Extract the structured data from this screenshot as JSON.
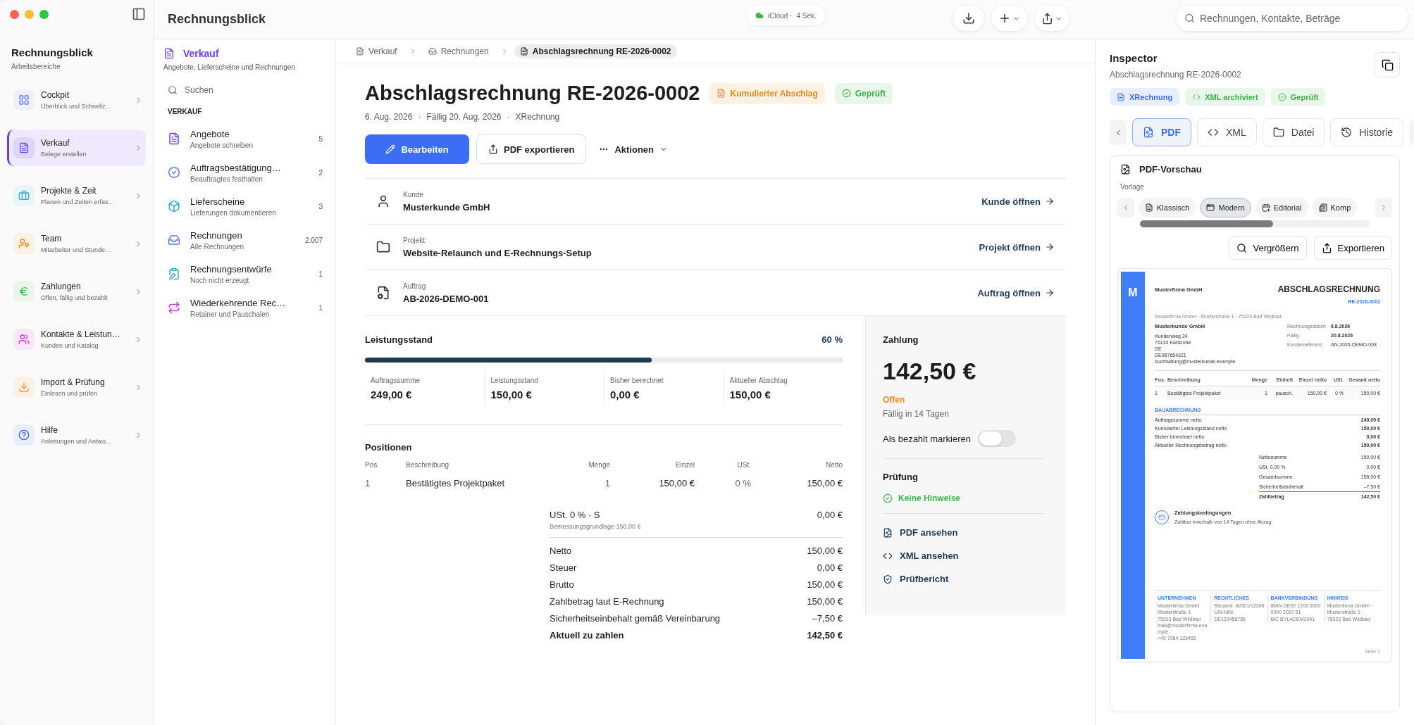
{
  "window": {
    "title": "Rechnungsblick"
  },
  "toolbar": {
    "sync_label": "iCloud ·",
    "sync_time": "4 Sek.",
    "search": {
      "placeholder": "Rechnungen, Kontakte, Beträge"
    }
  },
  "sidebar": {
    "title": "Rechnungsblick",
    "subtitle": "Arbeitsbereiche",
    "items": [
      {
        "label": "Cockpit",
        "sub": "Überblick und Schnellz…",
        "selected": false
      },
      {
        "label": "Verkauf",
        "sub": "Belege erstellen",
        "selected": true
      },
      {
        "label": "Projekte & Zeit",
        "sub": "Planen und Zeiten erfas…",
        "selected": false
      },
      {
        "label": "Team",
        "sub": "Mitarbeiter und Stunde…",
        "selected": false
      },
      {
        "label": "Zahlungen",
        "sub": "Offen, fällig und bezahlt",
        "selected": false
      },
      {
        "label": "Kontakte & Leistun…",
        "sub": "Kunden und Katalog",
        "selected": false
      },
      {
        "label": "Import & Prüfung",
        "sub": "Einlesen und prüfen",
        "selected": false
      },
      {
        "label": "Hilfe",
        "sub": "Anleitungen und Antwo…",
        "selected": false
      }
    ]
  },
  "list_pane": {
    "title": "Verkauf",
    "subtitle": "Angebote, Lieferscheine und Rechnungen",
    "search": {
      "placeholder": "Suchen"
    },
    "section": "VERKAUF",
    "items": [
      {
        "label": "Angebote",
        "sub": "Angebote schreiben",
        "count": "5"
      },
      {
        "label": "Auftragsbestätigung…",
        "sub": "Beauftragtes festhalten",
        "count": "2"
      },
      {
        "label": "Lieferscheine",
        "sub": "Lieferungen dokumentieren",
        "count": "3"
      },
      {
        "label": "Rechnungen",
        "sub": "Alle Rechnungen",
        "count": "2.007"
      },
      {
        "label": "Rechnungsentwürfe",
        "sub": "Noch nicht erzeugt",
        "count": "1"
      },
      {
        "label": "Wiederkehrende Rec…",
        "sub": "Retainer und Pauschalen",
        "count": "1"
      }
    ]
  },
  "breadcrumb": [
    {
      "label": "Verkauf",
      "selected": false
    },
    {
      "label": "Rechnungen",
      "selected": false
    },
    {
      "label": "Abschlagsrechnung RE-2026-0002",
      "selected": true
    }
  ],
  "document": {
    "title": "Abschlagsrechnung RE-2026-0002",
    "badges": [
      {
        "label": "Kumulierter Abschlag",
        "kind": "warning"
      },
      {
        "label": "Geprüft",
        "kind": "success"
      }
    ],
    "meta": [
      "6. Aug. 2026",
      "Fällig 20. Aug. 2026",
      "XRechnung"
    ],
    "meta_separator": "·",
    "actions": [
      {
        "label": "Bearbeiten",
        "kind": "primary"
      },
      {
        "label": "PDF exportieren",
        "kind": "secondary"
      },
      {
        "label": "Aktionen",
        "kind": "menu"
      }
    ],
    "links": [
      {
        "label": "Kunde",
        "value": "Musterkunde GmbH",
        "action": "Kunde öffnen"
      },
      {
        "label": "Projekt",
        "value": "Website-Relaunch und E-Rechnungs-Setup",
        "action": "Projekt öffnen"
      },
      {
        "label": "Auftrag",
        "value": "AB-2026-DEMO-001",
        "action": "Auftrag öffnen"
      }
    ],
    "progress": {
      "label": "Leistungsstand",
      "percent": "60 %",
      "level": 0.6
    },
    "stats": [
      {
        "label": "Auftragssumme",
        "value": "249,00 €"
      },
      {
        "label": "Leistungsstand",
        "value": "150,00 €"
      },
      {
        "label": "Bisher berechnet",
        "value": "0,00 €"
      },
      {
        "label": "Aktueller Abschlag",
        "value": "150,00 €"
      }
    ],
    "positions": {
      "title": "Positionen",
      "columns": [
        "Pos.",
        "Beschreibung",
        "Menge",
        "Einzel",
        "USt.",
        "Netto"
      ],
      "rows": [
        [
          "1",
          "Bestätigtes Projektpaket",
          "1",
          "150,00 €",
          "0 %",
          "150,00 €"
        ]
      ]
    },
    "tax": {
      "label": "USt. 0 % · S",
      "sub": "Bemessungsgrundlage 150,00 €",
      "value": "0,00 €"
    },
    "totals": [
      {
        "label": "Netto",
        "value": "150,00 €",
        "kind": "line"
      },
      {
        "label": "Steuer",
        "value": "0,00 €",
        "kind": "line"
      },
      {
        "label": "Brutto",
        "value": "150,00 €",
        "kind": "line"
      },
      {
        "label": "Zahlbetrag laut E-Rechnung",
        "value": "150,00 €",
        "kind": "line"
      },
      {
        "label": "Sicherheitseinbehalt gemäß Vereinbarung",
        "value": "–7,50 €",
        "kind": "line"
      },
      {
        "label": "Aktuell zu zahlen",
        "value": "142,50 €",
        "kind": "total"
      }
    ]
  },
  "payment": {
    "title": "Zahlung",
    "amount": "142,50 €",
    "status": "Offen",
    "due": "Fällig in 14 Tagen",
    "toggle": {
      "label": "Als bezahlt markieren",
      "on": false
    },
    "check_title": "Prüfung",
    "check_result": "Keine Hinweise",
    "links": [
      "PDF ansehen",
      "XML ansehen",
      "Prüfbericht"
    ]
  },
  "inspector": {
    "title": "Inspector",
    "subtitle": "Abschlagsrechnung RE-2026-0002",
    "badges": [
      {
        "label": "XRechnung",
        "kind": "info"
      },
      {
        "label": "XML archiviert",
        "kind": "success"
      },
      {
        "label": "Geprüft",
        "kind": "success"
      }
    ],
    "tabs": [
      {
        "label": "PDF",
        "selected": true
      },
      {
        "label": "XML",
        "selected": false
      },
      {
        "label": "Datei",
        "selected": false
      },
      {
        "label": "Historie",
        "selected": false
      }
    ],
    "preview": {
      "title": "PDF-Vorschau",
      "template_label": "Vorlage",
      "templates": [
        {
          "label": "Klassisch",
          "selected": false
        },
        {
          "label": "Modern",
          "selected": true
        },
        {
          "label": "Editorial",
          "selected": false
        },
        {
          "label": "Komp",
          "selected": false
        }
      ],
      "buttons": [
        "Vergrößern",
        "Exportieren"
      ]
    }
  },
  "pdf": {
    "logo": "M",
    "company": "Musterfirma GmbH",
    "heading": "ABSCHLAGSRECHNUNG",
    "number": "RE-2026-0002",
    "sender_line": "Musterfirma GmbH · Musterstraße 1 · 75323 Bad Wildbad",
    "customer": {
      "name": "Musterkunde GmbH",
      "lines": [
        "Kundenweg 24",
        "76133 Karlsruhe",
        "DE",
        "DE987654321",
        "buchhaltung@musterkunde.example"
      ]
    },
    "meta": [
      {
        "label": "Rechnungsdatum",
        "value": "6.8.2026"
      },
      {
        "label": "Fällig",
        "value": "20.8.2026"
      },
      {
        "label": "Kundenreferenz",
        "value": "AN-2026-DEMO-003"
      }
    ],
    "columns": [
      "Pos.",
      "Beschreibung",
      "Menge",
      "Einheit",
      "Einzel netto",
      "USt.",
      "Gesamt netto"
    ],
    "rows": [
      [
        "1",
        "Bestätigtes Projektpaket",
        "1",
        "pausch.",
        "150,00 €",
        "0 %",
        "150,00 €"
      ]
    ],
    "section": "BAUABRECHNUNG",
    "build_rows": [
      {
        "label": "Auftragssumme netto",
        "value": "249,00 €"
      },
      {
        "label": "Kumulierter Leistungsstand netto",
        "value": "150,00 €"
      },
      {
        "label": "Bisher berechnet netto",
        "value": "0,00 €"
      },
      {
        "label": "Aktueller Rechnungsbetrag netto",
        "value": "150,00 €"
      }
    ],
    "summary": [
      {
        "label": "Nettosumme",
        "value": "150,00 €",
        "kind": "line"
      },
      {
        "label": "USt. 0.00 %",
        "value": "0,00 €",
        "kind": "line"
      },
      {
        "label": "Gesamtsumme",
        "value": "150,00 €",
        "kind": "line"
      },
      {
        "label": "Sicherheitseinbehalt",
        "value": "–7,50 €",
        "kind": "line"
      },
      {
        "label": "Zahlbetrag",
        "value": "142,50 €",
        "kind": "total"
      }
    ],
    "terms_title": "Zahlungsbedingungen",
    "terms_text": "Zahlbar innerhalb von 14 Tagen ohne Abzug.",
    "footer": [
      {
        "title": "UNTERNEHMEN",
        "lines": [
          "Musterfirma GmbH",
          "Musterstraße 1",
          "75323 Bad Wildbad",
          "mail@musterfirma.example",
          "+49 7084 123456"
        ]
      },
      {
        "title": "RECHTLICHES",
        "lines": [
          "Steuernr. 42001/12345",
          "USt-IdNr.",
          "DE123456789"
        ]
      },
      {
        "title": "BANKVERBINDUNG",
        "lines": [
          "IBAN DE02 1203 0000 0000 2020 51",
          "BIC BYLADEM1001"
        ]
      },
      {
        "title": "HINWEIS",
        "lines": [
          "Musterfirma GmbH · Musterstraße 1 · 75323 Bad Wildbad"
        ]
      }
    ],
    "page": "Seite 1"
  }
}
